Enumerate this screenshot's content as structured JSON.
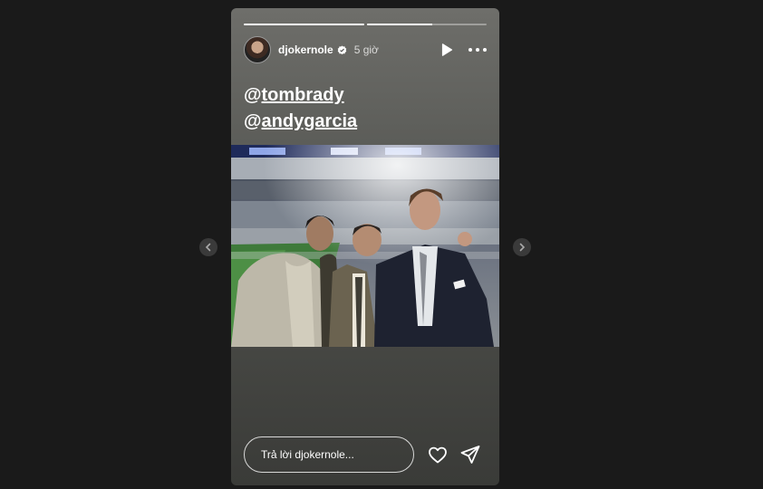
{
  "story": {
    "username": "djokernole",
    "time": "5 giờ",
    "progress": [
      1.0,
      0.55
    ],
    "mentions": [
      "tombrady",
      "andygarcia"
    ],
    "reply_placeholder": "Trả lời djokernole..."
  },
  "icons": {
    "prev": "chevron-left-icon",
    "next": "chevron-right-icon",
    "play": "play-icon",
    "more": "more-icon",
    "verified": "verified-badge-icon",
    "like": "heart-icon",
    "share": "send-icon"
  }
}
